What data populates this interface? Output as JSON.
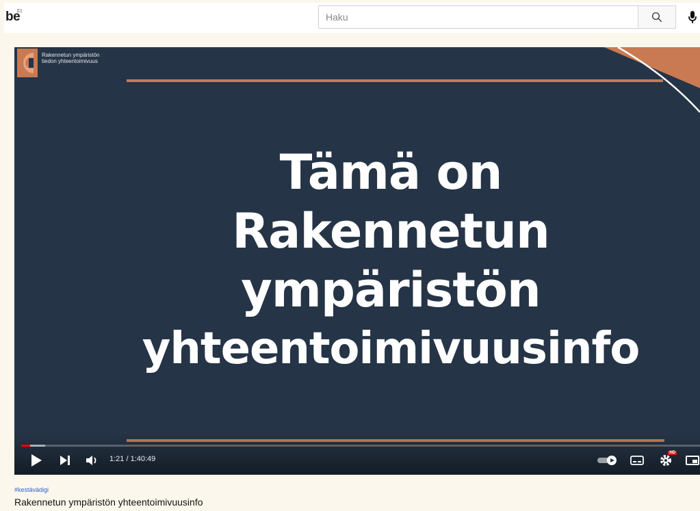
{
  "header": {
    "logo_text": "be",
    "country_code": "FI",
    "search_placeholder": "Haku"
  },
  "player": {
    "slide": {
      "org_line1": "Rakennetun ympäristön",
      "org_line2": "tiedon yhteentoimivuus",
      "title_lines": [
        "Tämä on",
        "Rakennetun",
        "ympäristön",
        "yhteentoimivuusinfo"
      ],
      "accent_color": "#c97a52",
      "background_color": "#253446"
    },
    "time_display": "1:21 / 1:40:49",
    "progress_fraction": 0.0134,
    "controls": {
      "play": "play-icon",
      "next": "next-icon",
      "volume": "volume-icon",
      "autoplay": "autoplay-toggle-icon",
      "subtitles": "subtitles-icon",
      "settings": "gear-icon",
      "settings_badge": "HD",
      "miniplayer": "miniplayer-icon"
    }
  },
  "video": {
    "hashtag": "#kestävädigi",
    "title": "Rakennetun ympäristön yhteentoimivuusinfo"
  }
}
